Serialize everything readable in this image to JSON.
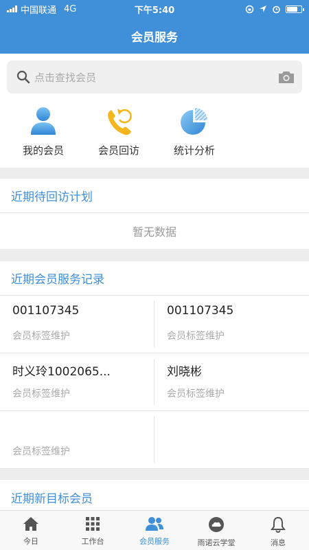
{
  "status_bar": {
    "carrier": "中国联通",
    "network": "4G",
    "time": "下午5:40"
  },
  "nav": {
    "title": "会员服务"
  },
  "search": {
    "placeholder": "点击查找会员",
    "left_icon": "search-icon",
    "right_icon": "camera-icon"
  },
  "quick_actions": [
    {
      "label": "我的会员",
      "icon": "member-person-icon"
    },
    {
      "label": "会员回访",
      "icon": "phone-callback-icon"
    },
    {
      "label": "统计分析",
      "icon": "pie-chart-icon"
    }
  ],
  "pending_visits": {
    "title": "近期待回访计划",
    "empty_text": "暂无数据"
  },
  "service_records": {
    "title": "近期会员服务记录",
    "items": [
      {
        "name": "001107345",
        "tag": "会员标签维护"
      },
      {
        "name": "001107345",
        "tag": "会员标签维护"
      },
      {
        "name": "时义玲1002065...",
        "tag": "会员标签维护"
      },
      {
        "name": "刘晓彬",
        "tag": "会员标签维护"
      },
      {
        "name": "",
        "tag": "会员标签维护"
      },
      {
        "name": "",
        "tag": ""
      }
    ]
  },
  "new_targets": {
    "title": "近期新目标会员"
  },
  "tabs": [
    {
      "label": "今日",
      "icon": "home-icon"
    },
    {
      "label": "工作台",
      "icon": "grid-icon"
    },
    {
      "label": "会员服务",
      "icon": "members-icon"
    },
    {
      "label": "雨诺云学堂",
      "icon": "cloud-icon"
    },
    {
      "label": "消息",
      "icon": "bell-icon"
    }
  ],
  "colors": {
    "primary": "#3f8fd9",
    "background": "#ededed",
    "text_muted": "#999999"
  }
}
